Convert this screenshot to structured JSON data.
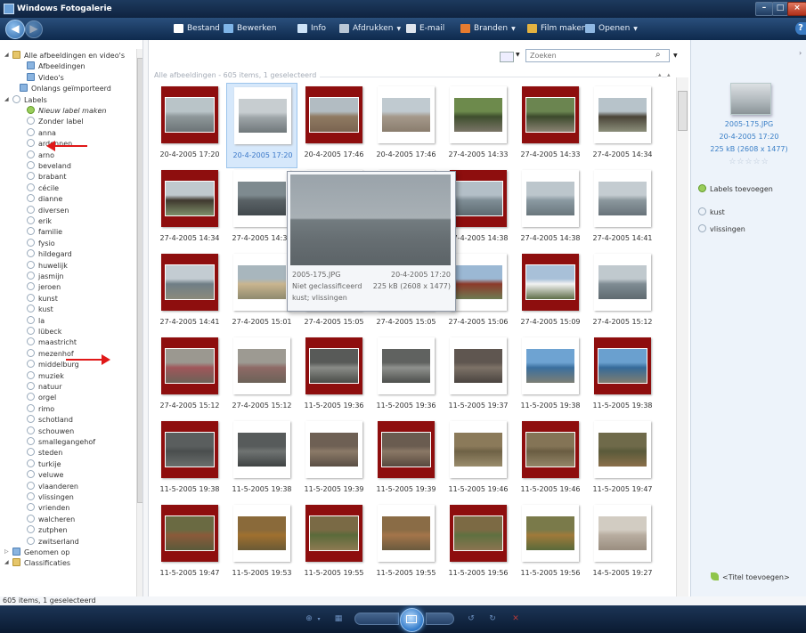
{
  "window": {
    "title": "Windows Fotogalerie",
    "min": "–",
    "max": "□",
    "close": "×"
  },
  "toolbar": {
    "back": "◀",
    "forward": "▶",
    "items": [
      {
        "label": "Bestand",
        "icon": "file-icon",
        "color": "#ffffff",
        "caret": true
      },
      {
        "label": "Bewerken",
        "icon": "edit-icon",
        "color": "#7fb5e8",
        "caret": false
      },
      {
        "label": "Info",
        "icon": "info-icon",
        "color": "#cde3f8",
        "caret": false
      },
      {
        "label": "Afdrukken",
        "icon": "printer-icon",
        "color": "#b9c7d6",
        "caret": true
      },
      {
        "label": "E-mail",
        "icon": "email-icon",
        "color": "#e0e6ee",
        "caret": false
      },
      {
        "label": "Branden",
        "icon": "burn-icon",
        "color": "#e67b2f",
        "caret": true
      },
      {
        "label": "Film maken",
        "icon": "film-icon",
        "color": "#e3b240",
        "caret": false
      },
      {
        "label": "Openen",
        "icon": "open-icon",
        "color": "#8fb8e2",
        "caret": true
      }
    ],
    "help": "?"
  },
  "nav": {
    "items": [
      {
        "label": "Alle afbeeldingen en video's",
        "icon": "folder"
      },
      {
        "label": "Afbeeldingen",
        "icon": "special"
      },
      {
        "label": "Video's",
        "icon": "special"
      },
      {
        "label": "Onlangs geïmporteerd",
        "icon": "special"
      },
      {
        "label": "Labels",
        "icon": "tag"
      },
      {
        "label": "Nieuw label maken",
        "icon": "green",
        "italic": true
      },
      {
        "label": "Zonder label",
        "icon": "tag"
      },
      {
        "label": "anna",
        "icon": "tag"
      },
      {
        "label": "ardennen",
        "icon": "tag"
      },
      {
        "label": "arno",
        "icon": "tag"
      },
      {
        "label": "beveland",
        "icon": "tag"
      },
      {
        "label": "brabant",
        "icon": "tag"
      },
      {
        "label": "cécile",
        "icon": "tag"
      },
      {
        "label": "dianne",
        "icon": "tag"
      },
      {
        "label": "diversen",
        "icon": "tag"
      },
      {
        "label": "erik",
        "icon": "tag"
      },
      {
        "label": "familie",
        "icon": "tag"
      },
      {
        "label": "fysio",
        "icon": "tag"
      },
      {
        "label": "hildegard",
        "icon": "tag"
      },
      {
        "label": "huwelijk",
        "icon": "tag"
      },
      {
        "label": "jasmijn",
        "icon": "tag"
      },
      {
        "label": "jeroen",
        "icon": "tag"
      },
      {
        "label": "kunst",
        "icon": "tag"
      },
      {
        "label": "kust",
        "icon": "tag"
      },
      {
        "label": "la",
        "icon": "tag"
      },
      {
        "label": "lübeck",
        "icon": "tag"
      },
      {
        "label": "maastricht",
        "icon": "tag"
      },
      {
        "label": "mezenhof",
        "icon": "tag"
      },
      {
        "label": "middelburg",
        "icon": "tag"
      },
      {
        "label": "muziek",
        "icon": "tag"
      },
      {
        "label": "natuur",
        "icon": "tag"
      },
      {
        "label": "orgel",
        "icon": "tag"
      },
      {
        "label": "rimo",
        "icon": "tag"
      },
      {
        "label": "schotland",
        "icon": "tag"
      },
      {
        "label": "schouwen",
        "icon": "tag"
      },
      {
        "label": "smallegangehof",
        "icon": "tag"
      },
      {
        "label": "steden",
        "icon": "tag"
      },
      {
        "label": "turkije",
        "icon": "tag"
      },
      {
        "label": "veluwe",
        "icon": "tag"
      },
      {
        "label": "vlaanderen",
        "icon": "tag"
      },
      {
        "label": "vlissingen",
        "icon": "tag"
      },
      {
        "label": "vrienden",
        "icon": "tag"
      },
      {
        "label": "walcheren",
        "icon": "tag"
      },
      {
        "label": "zutphen",
        "icon": "tag"
      },
      {
        "label": "zwitserland",
        "icon": "tag"
      },
      {
        "label": "Genomen op",
        "icon": "special"
      },
      {
        "label": "Classificaties",
        "icon": "folder"
      }
    ]
  },
  "search": {
    "placeholder": "Zoeken"
  },
  "group_header": "Alle afbeeldingen - 605 items, 1 geselecteerd",
  "thumbnails": [
    {
      "caption": "20-4-2005 17:20",
      "frame": "#8e0e0e",
      "photo": [
        "#b9c4c8",
        "#8e979a",
        "#6c7477"
      ]
    },
    {
      "caption": "20-4-2005 17:20",
      "frame": "#ffffff",
      "photo": [
        "#c7cdd0",
        "#9ea5a8",
        "#70787b"
      ],
      "selected": true
    },
    {
      "caption": "20-4-2005 17:46",
      "frame": "#8e0e0e",
      "photo": [
        "#b2bcc2",
        "#8f7a62",
        "#7a6450"
      ]
    },
    {
      "caption": "20-4-2005 17:46",
      "frame": "#ffffff",
      "photo": [
        "#c0cad0",
        "#a5998b",
        "#8a7d6e"
      ]
    },
    {
      "caption": "27-4-2005 14:33",
      "frame": "#ffffff",
      "photo": [
        "#6d8a4c",
        "#3f4f2e",
        "#7a7567"
      ]
    },
    {
      "caption": "27-4-2005 14:33",
      "frame": "#8e0e0e",
      "photo": [
        "#6b8550",
        "#3c4a2c",
        "#8a8373"
      ]
    },
    {
      "caption": "27-4-2005 14:34",
      "frame": "#ffffff",
      "photo": [
        "#b7c3ca",
        "#4a4438",
        "#8b8e7a"
      ]
    },
    {
      "caption": "27-4-2005 14:34",
      "frame": "#8e0e0e",
      "photo": [
        "#bfc9ce",
        "#3f382e",
        "#7e8f6a"
      ]
    },
    {
      "caption": "27-4-2005 14:35",
      "frame": "#ffffff",
      "photo": [
        "#7e8a8f",
        "#5a6266",
        "#42494d"
      ]
    },
    {
      "caption": "",
      "frame": "#ffffff",
      "photo": [
        "#999",
        "#888",
        "#777"
      ]
    },
    {
      "caption": "",
      "frame": "#ffffff",
      "photo": [
        "#999",
        "#888",
        "#777"
      ]
    },
    {
      "caption": "27-4-2005 14:38",
      "frame": "#8e0e0e",
      "photo": [
        "#b3bfc7",
        "#7f8e96",
        "#5e6a70"
      ]
    },
    {
      "caption": "27-4-2005 14:38",
      "frame": "#ffffff",
      "photo": [
        "#bcc6cc",
        "#8b9aa2",
        "#6a777d"
      ]
    },
    {
      "caption": "27-4-2005 14:41",
      "frame": "#ffffff",
      "photo": [
        "#c4ccd1",
        "#8c989e",
        "#68737a"
      ]
    },
    {
      "caption": "27-4-2005 14:41",
      "frame": "#8e0e0e",
      "photo": [
        "#c3ccd2",
        "#6f7e86",
        "#8b8a7c"
      ]
    },
    {
      "caption": "27-4-2005 15:01",
      "frame": "#ffffff",
      "photo": [
        "#a8b6bd",
        "#c9b58f",
        "#8f8a6e"
      ]
    },
    {
      "caption": "27-4-2005 15:05",
      "frame": "#ffffff",
      "photo": [
        "#999",
        "#888",
        "#777"
      ]
    },
    {
      "caption": "27-4-2005 15:05",
      "frame": "#ffffff",
      "photo": [
        "#999",
        "#888",
        "#777"
      ]
    },
    {
      "caption": "27-4-2005 15:06",
      "frame": "#ffffff",
      "photo": [
        "#9bb8d4",
        "#8c3a2a",
        "#6e7a52"
      ]
    },
    {
      "caption": "27-4-2005 15:09",
      "frame": "#8e0e0e",
      "photo": [
        "#a8c0d8",
        "#f2f2f2",
        "#5f6e48"
      ]
    },
    {
      "caption": "27-4-2005 15:12",
      "frame": "#ffffff",
      "photo": [
        "#c0c9ce",
        "#7f8c93",
        "#5f6a70"
      ]
    },
    {
      "caption": "27-4-2005 15:12",
      "frame": "#8e0e0e",
      "photo": [
        "#9b9890",
        "#a0565a",
        "#6c6258"
      ]
    },
    {
      "caption": "27-4-2005 15:12",
      "frame": "#ffffff",
      "photo": [
        "#9d9a92",
        "#8e6a66",
        "#6c6258"
      ]
    },
    {
      "caption": "11-5-2005 19:36",
      "frame": "#8e0e0e",
      "photo": [
        "#585a58",
        "#8a8c88",
        "#4a4c48"
      ]
    },
    {
      "caption": "11-5-2005 19:36",
      "frame": "#ffffff",
      "photo": [
        "#606260",
        "#8f918e",
        "#4d4f4c"
      ]
    },
    {
      "caption": "11-5-2005 19:37",
      "frame": "#ffffff",
      "photo": [
        "#5f5650",
        "#7d7267",
        "#4a4440"
      ]
    },
    {
      "caption": "11-5-2005 19:38",
      "frame": "#ffffff",
      "photo": [
        "#6ea3d2",
        "#3a6f9e",
        "#7c7e75"
      ]
    },
    {
      "caption": "11-5-2005 19:38",
      "frame": "#8e0e0e",
      "photo": [
        "#6aa0cf",
        "#356a99",
        "#7f7d70"
      ]
    },
    {
      "caption": "11-5-2005 19:38",
      "frame": "#8e0e0e",
      "photo": [
        "#5a5e5e",
        "#4a4e4e",
        "#6a6e6c"
      ]
    },
    {
      "caption": "11-5-2005 19:38",
      "frame": "#ffffff",
      "photo": [
        "#575b5b",
        "#6f7372",
        "#3f4343"
      ]
    },
    {
      "caption": "11-5-2005 19:39",
      "frame": "#ffffff",
      "photo": [
        "#6e6054",
        "#8b7a68",
        "#5a4e44"
      ]
    },
    {
      "caption": "11-5-2005 19:39",
      "frame": "#8e0e0e",
      "photo": [
        "#6a5c50",
        "#8a7866",
        "#58493e"
      ]
    },
    {
      "caption": "11-5-2005 19:46",
      "frame": "#ffffff",
      "photo": [
        "#8b7a5a",
        "#6f6246",
        "#9a8c6c"
      ]
    },
    {
      "caption": "11-5-2005 19:46",
      "frame": "#8e0e0e",
      "photo": [
        "#847456",
        "#6a5d42",
        "#948668"
      ]
    },
    {
      "caption": "11-5-2005 19:47",
      "frame": "#ffffff",
      "photo": [
        "#6f6a4a",
        "#5a5a3a",
        "#8a6f4a"
      ]
    },
    {
      "caption": "11-5-2005 19:47",
      "frame": "#8e0e0e",
      "photo": [
        "#6a6a42",
        "#8b5a3a",
        "#5a5a3a"
      ]
    },
    {
      "caption": "11-5-2005 19:53",
      "frame": "#ffffff",
      "photo": [
        "#8a6a3a",
        "#a0702f",
        "#6a5a35"
      ]
    },
    {
      "caption": "11-5-2005 19:55",
      "frame": "#8e0e0e",
      "photo": [
        "#7a6a45",
        "#5a6a3a",
        "#8e7a52"
      ]
    },
    {
      "caption": "11-5-2005 19:55",
      "frame": "#ffffff",
      "photo": [
        "#8a6c46",
        "#a4754a",
        "#6a5a3e"
      ]
    },
    {
      "caption": "11-5-2005 19:56",
      "frame": "#8e0e0e",
      "photo": [
        "#7c6a44",
        "#5f7040",
        "#8b7450"
      ]
    },
    {
      "caption": "11-5-2005 19:56",
      "frame": "#ffffff",
      "photo": [
        "#7a7a4a",
        "#a07a3a",
        "#5a6a3a"
      ]
    },
    {
      "caption": "14-5-2005 19:27",
      "frame": "#ffffff",
      "photo": [
        "#d2ccc2",
        "#b8ada0",
        "#9a8e80"
      ]
    }
  ],
  "tooltip": {
    "filename": "2005-175.JPG",
    "datetime": "20-4-2005 17:20",
    "rating": "Niet geclassificeerd",
    "size": "225 kB (2608 x 1477)",
    "tags": "kust; vlissingen"
  },
  "info": {
    "filename": "2005-175.JPG",
    "datetime": "20-4-2005   17:20",
    "size": "225 kB (2608 x 1477)",
    "stars": "☆☆☆☆☆",
    "add_labels": "Labels toevoegen",
    "labels": [
      "kust",
      "vlissingen"
    ],
    "add_title": "<Titel toevoegen>"
  },
  "status": "605 items, 1 geselecteerd"
}
